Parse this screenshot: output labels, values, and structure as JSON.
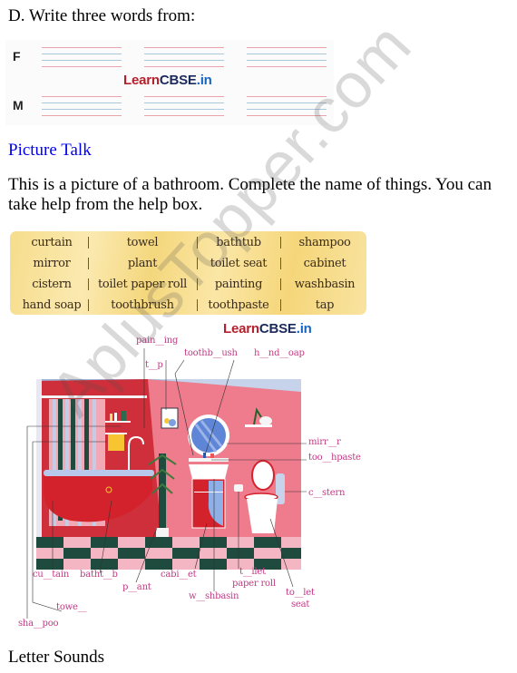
{
  "section_d": {
    "heading": "D. Write three words from:",
    "rows": [
      {
        "letter": "F"
      },
      {
        "letter": "M"
      }
    ],
    "brand": {
      "part1": "Learn",
      "part2": "CBSE",
      "part3": ".in"
    }
  },
  "picture_talk": {
    "heading": "Picture Talk",
    "instruction": "This is a picture of a bathroom. Complete the name of things. You can take help from the help box."
  },
  "help_box": {
    "rows": [
      [
        "curtain",
        "towel",
        "bathtub",
        "shampoo"
      ],
      [
        "mirror",
        "plant",
        "toilet seat",
        "cabinet"
      ],
      [
        "cistern",
        "toilet paper roll",
        "painting",
        "washbasin"
      ],
      [
        "hand soap",
        "toothbrush",
        "toothpaste",
        "tap"
      ]
    ],
    "background_color": "#f6dd8c"
  },
  "illustration": {
    "brand": {
      "part1": "Learn",
      "part2": "CBSE",
      "part3": ".in"
    },
    "label_color": "#c23a85",
    "labels": {
      "painting": "pain__ing",
      "toothbrush": "toothb__ush",
      "hand_soap": "h__nd__oap",
      "tap": "t__p",
      "mirror": "mirr__r",
      "toothpaste": "too__hpaste",
      "cistern": "c__stern",
      "curtain": "cu__tain",
      "bathtub": "batht__b",
      "plant": "p__ant",
      "cabinet": "cabi__et",
      "toilet_paper_roll_1": "t__ilet",
      "toilet_paper_roll_2": "paper roll",
      "washbasin": "w__shbasin",
      "toilet_seat_1": "to__let",
      "toilet_seat_2": "seat",
      "towel": "towe__",
      "shampoo": "sha__poo"
    }
  },
  "next_section": {
    "heading": "Letter Sounds"
  },
  "watermark": "AplusTopper.com"
}
